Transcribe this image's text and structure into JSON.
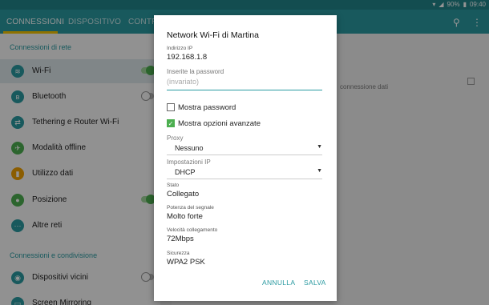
{
  "statusbar": {
    "battery": "90%",
    "time": "09:40"
  },
  "tabs": {
    "connessioni": "CONNESSIONI",
    "dispositivo": "DISPOSITIVO",
    "controlli": "CONTR"
  },
  "left": {
    "section1": "Connessioni di rete",
    "section2": "Connessioni e condivisione",
    "items": [
      {
        "label": "Wi-Fi",
        "color": "#2a9aa1",
        "toggle": "on"
      },
      {
        "label": "Bluetooth",
        "color": "#2a9aa1",
        "toggle": "off"
      },
      {
        "label": "Tethering e Router Wi-Fi",
        "color": "#2a9aa1"
      },
      {
        "label": "Modalità offline",
        "color": "#4caf50"
      },
      {
        "label": "Utilizzo dati",
        "color": "#f0a000"
      },
      {
        "label": "Posizione",
        "color": "#4caf50",
        "toggle": "on"
      },
      {
        "label": "Altre reti",
        "color": "#2a9aa1"
      },
      {
        "label": "Dispositivi vicini",
        "color": "#2a9aa1",
        "toggle": "off"
      },
      {
        "label": "Screen Mirroring",
        "color": "#2a9aa1"
      }
    ]
  },
  "background": {
    "right_snippet": "connessione dati"
  },
  "dialog": {
    "title": "Network Wi-Fi di Martina",
    "ip_label": "Indirizzo IP",
    "ip_value": "192.168.1.8",
    "password_label": "Inserite la password",
    "password_placeholder": "(invariato)",
    "show_password": "Mostra password",
    "show_advanced": "Mostra opzioni avanzate",
    "proxy_label": "Proxy",
    "proxy_value": "Nessuno",
    "ip_settings_label": "Impostazioni IP",
    "ip_settings_value": "DHCP",
    "status_label": "Stato",
    "status_value": "Collegato",
    "signal_label": "Potenza del segnale",
    "signal_value": "Molto forte",
    "speed_label": "Velocità collegamento",
    "speed_value": "72Mbps",
    "security_label": "Sicurezza",
    "security_value": "WPA2 PSK",
    "cancel": "ANNULLA",
    "save": "SALVA"
  }
}
